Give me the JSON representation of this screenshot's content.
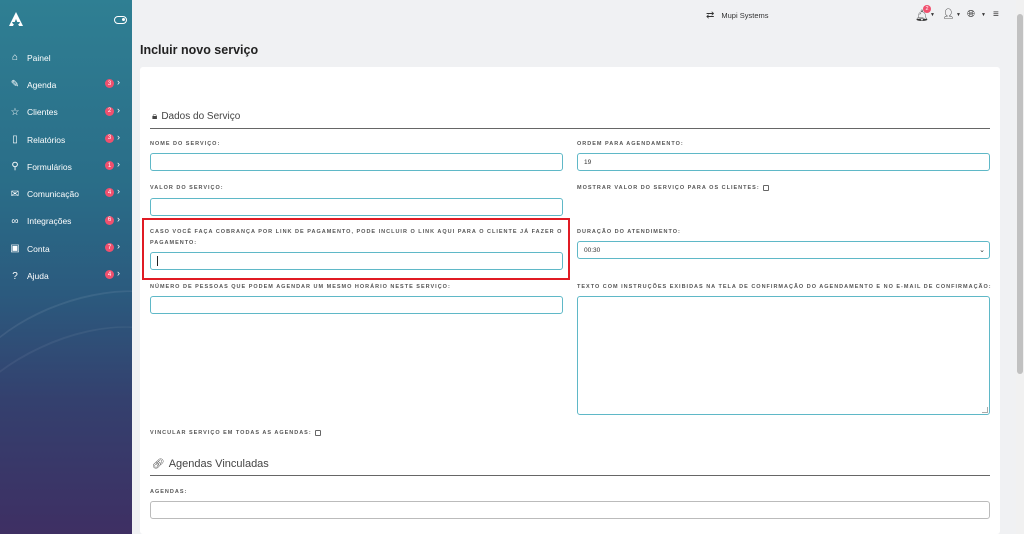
{
  "sidebar": {
    "items": [
      {
        "label": "Painel",
        "icon": "home-icon",
        "glyph": "⌂",
        "badge": "",
        "chev": ""
      },
      {
        "label": "Agenda",
        "icon": "edit-icon",
        "glyph": "✎",
        "badge": "3",
        "chev": "›"
      },
      {
        "label": "Clientes",
        "icon": "star-icon",
        "glyph": "☆",
        "badge": "2",
        "chev": "›"
      },
      {
        "label": "Relatórios",
        "icon": "book-icon",
        "glyph": "▯",
        "badge": "3",
        "chev": "›"
      },
      {
        "label": "Formulários",
        "icon": "search-icon",
        "glyph": "⚲",
        "badge": "1",
        "chev": "›"
      },
      {
        "label": "Comunicação",
        "icon": "mail-icon",
        "glyph": "✉",
        "badge": "4",
        "chev": "›"
      },
      {
        "label": "Integrações",
        "icon": "link-icon",
        "glyph": "∞",
        "badge": "6",
        "chev": "›"
      },
      {
        "label": "Conta",
        "icon": "briefcase-icon",
        "glyph": "▣",
        "badge": "7",
        "chev": "›"
      },
      {
        "label": "Ajuda",
        "icon": "help-icon",
        "glyph": "?",
        "badge": "4",
        "chev": "›"
      }
    ]
  },
  "topbar": {
    "company": "Mupi Systems",
    "notifications": "2"
  },
  "page": {
    "title": "Incluir novo serviço"
  },
  "form": {
    "section1": "Dados do Serviço",
    "nome_label": "NOME DO SERVIÇO:",
    "nome_value": "",
    "ordem_label": "ORDEM PARA AGENDAMENTO:",
    "ordem_value": "19",
    "valor_label": "VALOR DO SERVIÇO:",
    "valor_value": "",
    "mostrar_label": "MOSTRAR VALOR DO SERVIÇO PARA OS CLIENTES:",
    "link_label_1": "CASO VOCÊ FAÇA COBRANÇA POR LINK DE PAGAMENTO, PODE INCLUIR O LINK AQUI PARA O CLIENTE JÁ FAZER O",
    "link_label_2": "PAGAMENTO:",
    "duracao_label": "DURAÇÃO DO ATENDIMENTO:",
    "duracao_value": "00:30",
    "pessoas_label": "NÚMERO DE PESSOAS QUE PODEM AGENDAR UM MESMO HORÁRIO NESTE SERVIÇO:",
    "texto_label": "TEXTO COM INSTRUÇÕES EXIBIDAS NA TELA DE CONFIRMAÇÃO DO AGENDAMENTO E NO E-MAIL DE CONFIRMAÇÃO:",
    "vincular_label": "VINCULAR SERVIÇO EM TODAS AS AGENDAS:",
    "section2": "Agendas Vinculadas",
    "agendas_label": "AGENDAS:"
  }
}
